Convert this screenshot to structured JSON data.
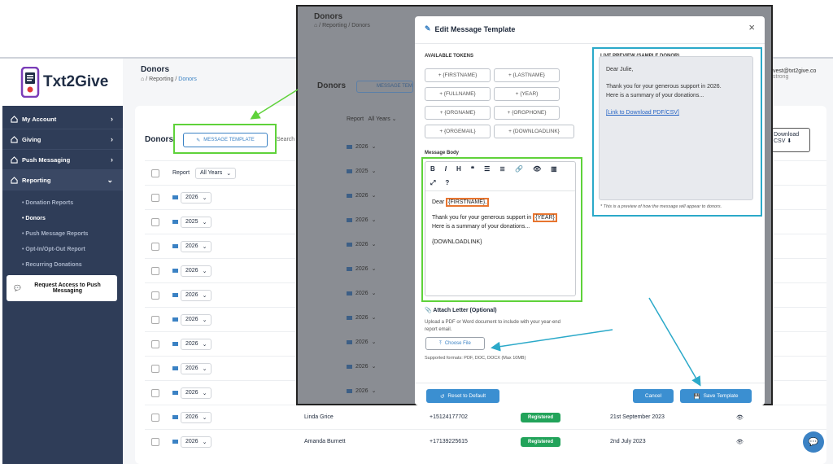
{
  "sidebar": {
    "logo_text": "Txt2Give",
    "items": [
      {
        "label": "My Account"
      },
      {
        "label": "Giving"
      },
      {
        "label": "Push Messaging"
      },
      {
        "label": "Reporting"
      }
    ],
    "subitems": [
      "Donation Reports",
      "Donors",
      "Push Message Reports",
      "Opt-In/Opt-Out Report",
      "Recurring Donations"
    ],
    "request_button": "Request Access to Push Messaging"
  },
  "page": {
    "title": "Donors",
    "breadcrumb": [
      "Reporting",
      "Donors"
    ],
    "donors_heading": "Donors",
    "message_template_button": "MESSAGE TEMPLATE",
    "search_label": "Search",
    "report_label": "Report",
    "year_filter": "All Years",
    "email_snippet": "vest@txt2give.co",
    "strong_snippet": "strong",
    "download_label": "Download",
    "csv_label": "CSV",
    "rows": [
      {
        "year": "2026",
        "name": "",
        "phone": "",
        "status": "",
        "date": ""
      },
      {
        "year": "2025",
        "name": "",
        "phone": "",
        "status": "",
        "date": ""
      },
      {
        "year": "2026",
        "name": "",
        "phone": "",
        "status": "",
        "date": ""
      },
      {
        "year": "2026",
        "name": "",
        "phone": "",
        "status": "",
        "date": ""
      },
      {
        "year": "2026",
        "name": "",
        "phone": "",
        "status": "",
        "date": ""
      },
      {
        "year": "2026",
        "name": "",
        "phone": "",
        "status": "",
        "date": ""
      },
      {
        "year": "2026",
        "name": "",
        "phone": "",
        "status": "",
        "date": ""
      },
      {
        "year": "2026",
        "name": "",
        "phone": "",
        "status": "",
        "date": ""
      },
      {
        "year": "2026",
        "name": "",
        "phone": "",
        "status": "",
        "date": ""
      },
      {
        "year": "2026",
        "name": "Linda Grice",
        "phone": "+15124177702",
        "status": "Registered",
        "date": "21st September 2023"
      },
      {
        "year": "2026",
        "name": "Amanda Burnett",
        "phone": "+17139225615",
        "status": "Registered",
        "date": "2nd July 2023"
      }
    ]
  },
  "overlay": {
    "title": "Donors",
    "breadcrumb": [
      "Reporting",
      "Donors"
    ],
    "donors_heading": "Donors",
    "message_button": "MESSAGE TEM",
    "report_label": "Report",
    "year_filter": "All Years",
    "years": [
      "2026",
      "2025",
      "2026",
      "2026",
      "2026",
      "2026",
      "2026",
      "2026",
      "2026",
      "2026",
      "2026"
    ]
  },
  "modal": {
    "title": "Edit Message Template",
    "tokens_label": "AVAILABLE TOKENS",
    "tokens": [
      "+ {FIRSTNAME}",
      "+ {LASTNAME}",
      "+ {FULLNAME}",
      "+ {YEAR}",
      "+ {ORGNAME}",
      "+ {ORGPHONE}",
      "+ {ORGEMAIL}",
      "+ {DOWNLOADLINK}"
    ],
    "message_body_label": "Message Body",
    "toolbar": [
      "B",
      "I",
      "H",
      "❝",
      "☰",
      "≣",
      "🔗",
      "👁",
      "▥",
      "⤢",
      "?"
    ],
    "body": {
      "dear": "Dear",
      "firstname_token": "{FIRSTNAME},",
      "line2_start": "Thank you for your generous support in",
      "year_token": "{YEAR}",
      "line3": "Here is a summary of your donations...",
      "line4": "{DOWNLOADLINK}"
    },
    "attach_label": "Attach Letter (Optional)",
    "attach_desc": "Upload a PDF or Word document to include with your year-end report email.",
    "choose_file": "Choose File",
    "formats": "Supported formats: PDF, DOC, DOCX (Max 10MB)",
    "preview_label": "LIVE PREVIEW (SAMPLE DONOR)",
    "preview": {
      "greeting": "Dear Julie,",
      "line1": "Thank you for your generous support in 2026.",
      "line2": "Here is a summary of your donations...",
      "link": "[Link to Download PDF/CSV]"
    },
    "preview_note": "* This is a preview of how the message will appear to donors.",
    "reset_button": "Reset to Default",
    "cancel_button": "Cancel",
    "save_button": "Save Template"
  }
}
